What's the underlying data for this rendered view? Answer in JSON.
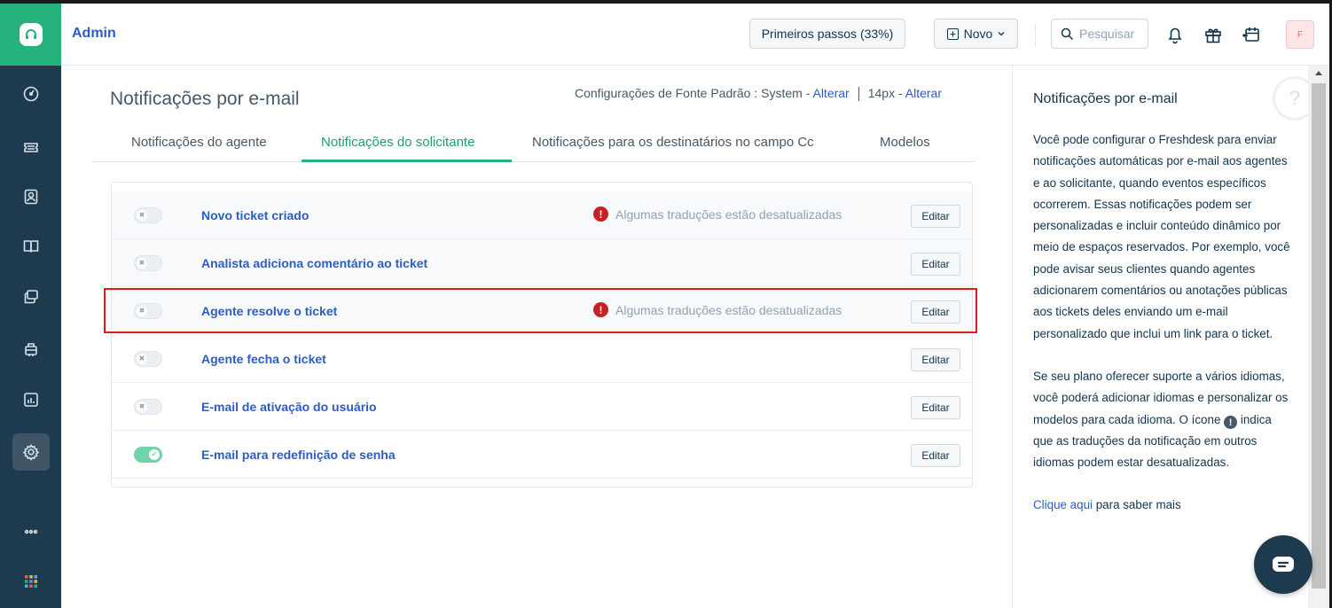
{
  "header": {
    "title": "Admin",
    "getting_started": "Primeiros passos (33%)",
    "new_button": "Novo",
    "search_placeholder": "Pesquisar",
    "avatar_initial": "F"
  },
  "sidebar": {
    "items": [
      {
        "icon": "dashboard-icon"
      },
      {
        "icon": "tickets-icon"
      },
      {
        "icon": "contacts-icon"
      },
      {
        "icon": "knowledge-base-icon"
      },
      {
        "icon": "forums-icon"
      },
      {
        "icon": "automation-icon"
      },
      {
        "icon": "reports-icon"
      },
      {
        "icon": "admin-settings-icon",
        "active": true
      },
      {
        "icon": "more-icon"
      },
      {
        "icon": "apps-grid-icon"
      }
    ]
  },
  "main": {
    "title": "Notificações por e-mail",
    "font_config": {
      "label": "Configurações de Fonte Padrão : System - ",
      "alter1": "Alterar",
      "size": "14px - ",
      "alter2": "Alterar"
    },
    "tabs": [
      {
        "label": "Notificações do agente"
      },
      {
        "label": "Notificações do solicitante",
        "active": true
      },
      {
        "label": "Notificações para os destinatários no campo Cc"
      },
      {
        "label": "Modelos"
      }
    ],
    "edit_label": "Editar",
    "warning_text": "Algumas traduções estão desatualizadas",
    "notifications": [
      {
        "label": "Novo ticket criado",
        "enabled": false,
        "warning": true
      },
      {
        "label": "Analista adiciona comentário ao ticket",
        "enabled": false,
        "warning": false
      },
      {
        "label": "Agente resolve o ticket",
        "enabled": false,
        "warning": true
      },
      {
        "label": "Agente fecha o ticket",
        "enabled": false,
        "warning": false
      },
      {
        "label": "E-mail de ativação do usuário",
        "enabled": false,
        "warning": false
      },
      {
        "label": "E-mail para redefinição de senha",
        "enabled": true,
        "warning": false
      }
    ]
  },
  "panel": {
    "title": "Notificações por e-mail",
    "para1": "Você pode configurar o Freshdesk para enviar notificações automáticas por e-mail aos agentes e ao solicitante, quando eventos específicos ocorrerem. Essas notificações podem ser personalizadas e incluir conteúdo dinâmico por meio de espaços reservados. Por exemplo, você pode avisar seus clientes quando agentes adicionarem comentários ou anotações públicas aos tickets deles enviando um e-mail personalizado que inclui um link para o ticket.",
    "para2_a": "Se seu plano oferecer suporte a vários idiomas, você poderá adicionar idiomas e personalizar os modelos para cada idioma. O ícone ",
    "para2_b": " indica que as traduções da notificação em outros idiomas podem estar desatualizadas.",
    "link": "Clique aqui",
    "link_suffix": " para saber mais",
    "help_glyph": "?"
  },
  "colors": {
    "brand_green": "#26b27d",
    "sidebar_bg": "#1d3a4e",
    "link_blue": "#2c5cc5",
    "warning_red": "#c82124",
    "highlight_red": "#e01b1b"
  }
}
